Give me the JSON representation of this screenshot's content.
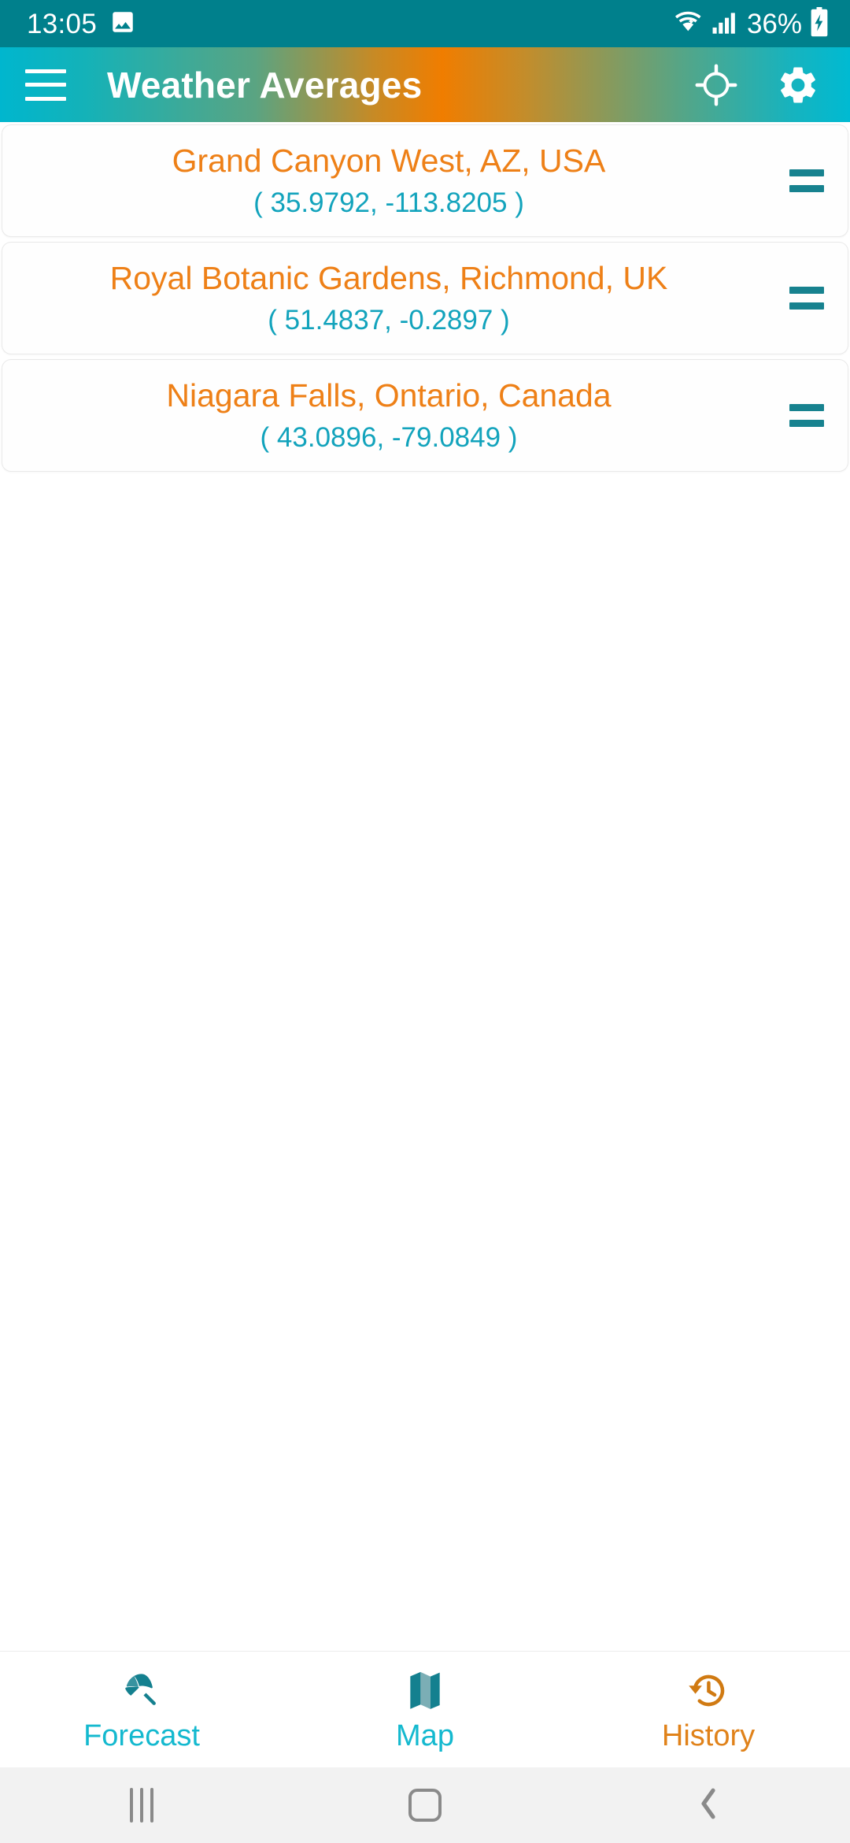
{
  "status_bar": {
    "time": "13:05",
    "battery_percent": "36%",
    "icons": [
      "gallery-image-icon",
      "wifi-icon",
      "cellular-signal-icon",
      "battery-charging-icon"
    ],
    "background_color": "#00808C"
  },
  "app_bar": {
    "title": "Weather Averages",
    "menu_icon": "hamburger-menu-icon",
    "actions": [
      {
        "name": "gps-locate-icon",
        "label": "My Location"
      },
      {
        "name": "settings-gear-icon",
        "label": "Settings"
      }
    ],
    "gradient_start_color": "#00B6CE",
    "gradient_mid_color": "#F07D00",
    "gradient_end_color": "#00BAD2"
  },
  "locations": [
    {
      "name": "Grand Canyon West, AZ, USA",
      "coordinates": "( 35.9792, -113.8205 )",
      "latitude": 35.9792,
      "longitude": -113.8205,
      "drag_handle": "drag-handle-icon"
    },
    {
      "name": "Royal Botanic Gardens, Richmond, UK",
      "coordinates": "( 51.4837, -0.2897 )",
      "latitude": 51.4837,
      "longitude": -0.2897,
      "drag_handle": "drag-handle-icon"
    },
    {
      "name": "Niagara Falls, Ontario, Canada",
      "coordinates": "( 43.0896, -79.0849 )",
      "latitude": 43.0896,
      "longitude": -79.0849,
      "drag_handle": "drag-handle-icon"
    }
  ],
  "colors": {
    "location_name": "#EE8017",
    "location_coords": "#12A3BC",
    "drag_handle": "#17828F",
    "tab_active": "#14B9CF",
    "tab_history": "#E0821A",
    "card_background": "#FEFEFE"
  },
  "tab_bar": {
    "tabs": [
      {
        "label": "Forecast",
        "icon": "beach-umbrella-icon",
        "color": "#14B9CF"
      },
      {
        "label": "Map",
        "icon": "folded-map-icon",
        "color": "#14B9CF"
      },
      {
        "label": "History",
        "icon": "clock-history-icon",
        "color": "#E0821A"
      }
    ]
  },
  "android_nav_bar": {
    "buttons": [
      {
        "name": "recents-button",
        "icon": "recents-icon"
      },
      {
        "name": "home-button",
        "icon": "home-icon"
      },
      {
        "name": "back-button",
        "icon": "back-chevron-icon"
      }
    ],
    "background_color": "#F2F2F2"
  }
}
